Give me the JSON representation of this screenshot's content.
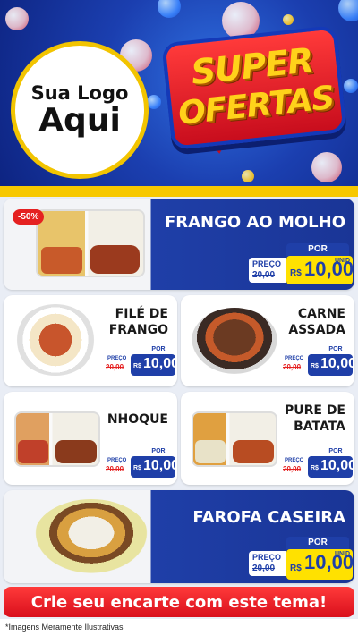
{
  "header": {
    "logo_line1": "Sua Logo",
    "logo_line2": "Aqui",
    "badge_word1": "SUPER",
    "badge_word2": "OFERTAS"
  },
  "products": [
    {
      "name": "FRANGO AO MOLHO",
      "discount": "-50%",
      "por_label": "POR",
      "preco_label": "PREÇO",
      "old_price": "20,00",
      "currency": "R$",
      "price": "10,00",
      "unit": "UNID"
    },
    {
      "name_line1": "FILÉ DE",
      "name_line2": "FRANGO",
      "por_label": "POR",
      "preco_label": "PREÇO",
      "old_price": "20,00",
      "currency": "R$",
      "price": "10,00"
    },
    {
      "name_line1": "CARNE",
      "name_line2": "ASSADA",
      "por_label": "POR",
      "preco_label": "PREÇO",
      "old_price": "20,00",
      "currency": "R$",
      "price": "10,00"
    },
    {
      "name": "NHOQUE",
      "por_label": "POR",
      "preco_label": "PREÇO",
      "old_price": "20,00",
      "currency": "R$",
      "price": "10,00"
    },
    {
      "name_line1": "PURE DE",
      "name_line2": "BATATA",
      "por_label": "POR",
      "preco_label": "PREÇO",
      "old_price": "20,00",
      "currency": "R$",
      "price": "10,00"
    },
    {
      "name": "FAROFA CASEIRA",
      "por_label": "POR",
      "preco_label": "PREÇO",
      "old_price": "20,00",
      "currency": "R$",
      "price": "10,00",
      "unit": "UNID"
    }
  ],
  "cta": "Crie seu encarte com este tema!",
  "note": "*Imagens Meramente Ilustrativas",
  "colors": {
    "brand_blue": "#1f3fa8",
    "accent_red": "#e52121",
    "accent_yellow": "#ffe100"
  }
}
